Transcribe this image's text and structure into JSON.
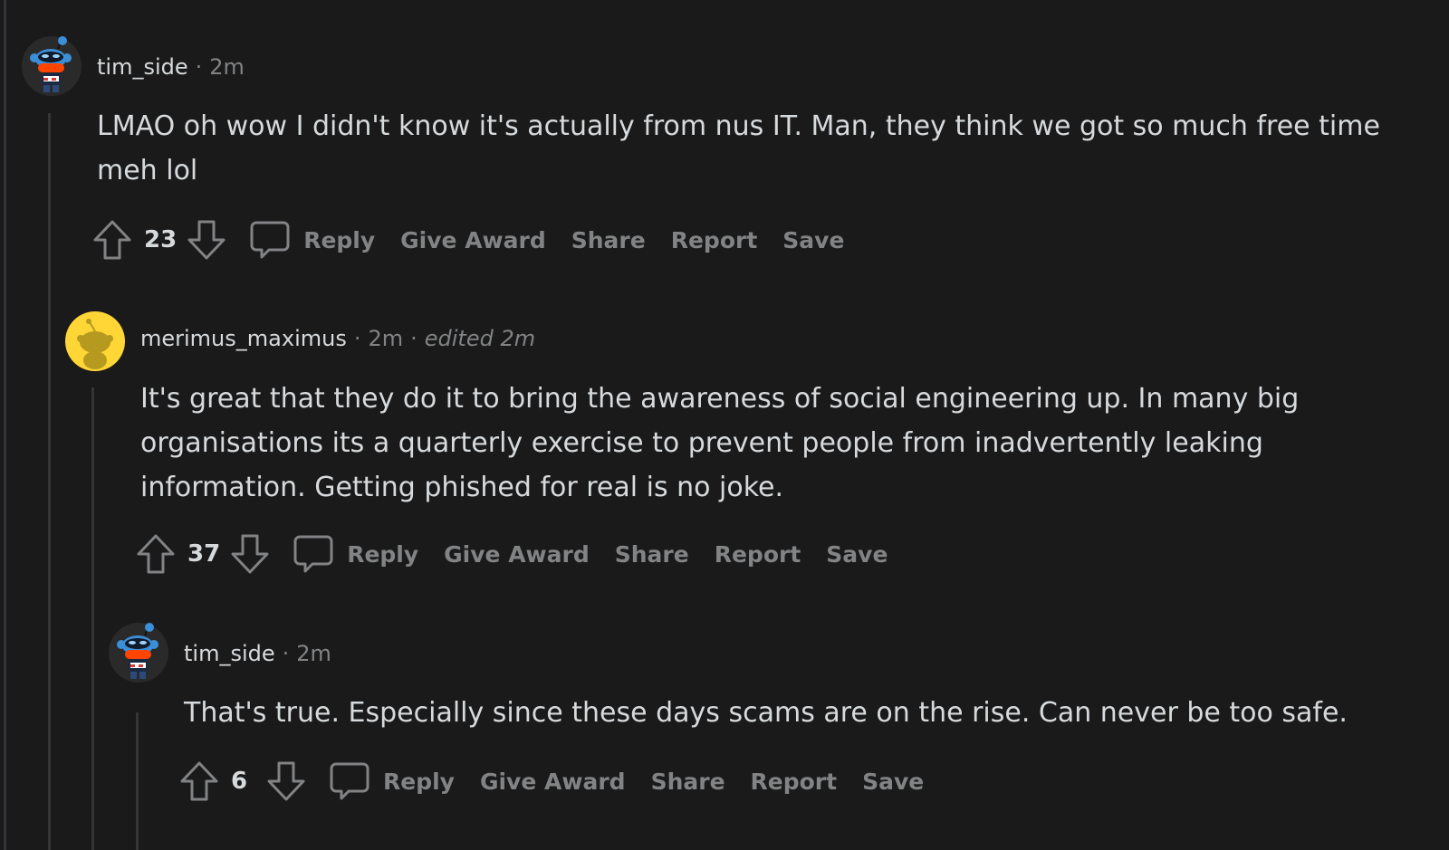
{
  "comments": [
    {
      "username": "tim_side",
      "time": "2m",
      "edited": "",
      "body": "LMAO oh wow I didn't know it's actually from nus IT. Man, they think we got so much free time meh lol",
      "score": "23",
      "actions": {
        "reply": "Reply",
        "give_award": "Give Award",
        "share": "Share",
        "report": "Report",
        "save": "Save"
      }
    },
    {
      "username": "merimus_maximus",
      "time": "2m",
      "edited": "edited 2m",
      "body": "It's great that they do it to bring the awareness of social engineering up. In many big organisations its a quarterly exercise to prevent people from inadvertently leaking information. Getting phished for real is no joke.",
      "score": "37",
      "actions": {
        "reply": "Reply",
        "give_award": "Give Award",
        "share": "Share",
        "report": "Report",
        "save": "Save"
      }
    },
    {
      "username": "tim_side",
      "time": "2m",
      "edited": "",
      "body": "That's true. Especially since these days scams are on the rise. Can never be too safe.",
      "score": "6",
      "actions": {
        "reply": "Reply",
        "give_award": "Give Award",
        "share": "Share",
        "report": "Report",
        "save": "Save"
      }
    }
  ],
  "separator": "·",
  "icons": {
    "upvote": "upvote-arrow-icon",
    "downvote": "downvote-arrow-icon",
    "reply": "speech-bubble-icon",
    "avatar_tim": "snoo-avatar-icon",
    "avatar_merimus": "default-snoo-avatar-icon"
  },
  "colors": {
    "background": "#1a1a1b",
    "text": "#d7dadc",
    "meta": "#818384",
    "thread_line": "#343536",
    "avatar_yellow": "#ffd635"
  }
}
